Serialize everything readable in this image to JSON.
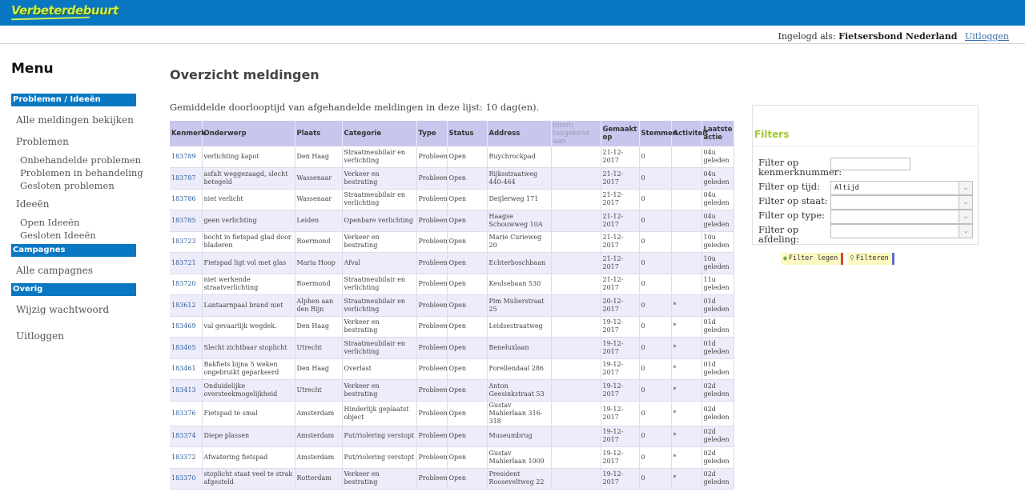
{
  "header": {
    "logo_text": "Verbeterdebuurt",
    "logged_in_prefix": "Ingelogd als:",
    "user_name": "Fietsersbond Nederland",
    "logout_link": "Uitloggen"
  },
  "sidebar": {
    "title": "Menu",
    "section_problems": "Problemen / Ideeën",
    "all_reports": "Alle meldingen bekijken",
    "problems": "Problemen",
    "unhandled": "Onbehandelde problemen",
    "in_progress": "Problemen in behandeling",
    "closed_problems": "Gesloten problemen",
    "ideas": "Ideeën",
    "open_ideas": "Open Ideeën",
    "closed_ideas": "Gesloten Ideeën",
    "section_campaigns": "Campagnes",
    "all_campaigns": "Alle campagnes",
    "section_other": "Overig",
    "change_password": "Wijzig wachtwoord",
    "logout": "Uitloggen"
  },
  "main": {
    "title": "Overzicht meldingen",
    "average_line": "Gemiddelde doorlooptijd van afgehandelde meldingen in deze lijst: 10 dag(en).",
    "columns": {
      "kenmerk": "Kenmerk",
      "onderwerp": "Onderwerp",
      "plaats": "Plaats",
      "categorie": "Categorie",
      "type": "Type",
      "status": "Status",
      "address": "Address",
      "intern": "Intern toegekend aan",
      "gemaakt": "Gemaakt op",
      "stemmen": "Stemmen",
      "activiteit": "Activiteit",
      "laatste": "Laatste actie"
    },
    "rows": [
      {
        "id": "183789",
        "subject": "verlichting kapot",
        "place": "Den Haag",
        "category": "Straatmeubilair en verlichting",
        "type": "Probleem",
        "status": "Open",
        "address": "Ruychrockpad",
        "intern": "",
        "created": "21-12-2017",
        "votes": "0",
        "activity": "",
        "last": "04u geleden"
      },
      {
        "id": "183787",
        "subject": "asfalt weggezaagd, slecht betegeld",
        "place": "Wassenaar",
        "category": "Verkeer en bestrating",
        "type": "Probleem",
        "status": "Open",
        "address": "Rijksstraatweg 440-464",
        "intern": "",
        "created": "21-12-2017",
        "votes": "0",
        "activity": "",
        "last": "04u geleden"
      },
      {
        "id": "183786",
        "subject": "niet verlicht",
        "place": "Wassenaar",
        "category": "Straatmeubilair en verlichting",
        "type": "Probleem",
        "status": "Open",
        "address": "Deijlerweg 171",
        "intern": "",
        "created": "21-12-2017",
        "votes": "0",
        "activity": "",
        "last": "04u geleden"
      },
      {
        "id": "183785",
        "subject": "geen verlichting",
        "place": "Leiden",
        "category": "Openbare verlichting",
        "type": "Probleem",
        "status": "Open",
        "address": "Haagse Schouwweg 10A",
        "intern": "",
        "created": "21-12-2017",
        "votes": "0",
        "activity": "",
        "last": "04u geleden"
      },
      {
        "id": "183723",
        "subject": "bocht in fietspad glad door bladeren",
        "place": "Roermond",
        "category": "Verkeer en bestrating",
        "type": "Probleem",
        "status": "Open",
        "address": "Marie Curieweg 20",
        "intern": "",
        "created": "21-12-2017",
        "votes": "0",
        "activity": "",
        "last": "10u geleden"
      },
      {
        "id": "183721",
        "subject": "Fietspad ligt vol met glas",
        "place": "Maria Hoop",
        "category": "Afval",
        "type": "Probleem",
        "status": "Open",
        "address": "Echterboschbaan",
        "intern": "",
        "created": "21-12-2017",
        "votes": "0",
        "activity": "",
        "last": "10u geleden"
      },
      {
        "id": "183720",
        "subject": "niet werkende straatverlichting",
        "place": "Roermond",
        "category": "Straatmeubilair en verlichting",
        "type": "Probleem",
        "status": "Open",
        "address": "Keulsebaan 530",
        "intern": "",
        "created": "21-12-2017",
        "votes": "0",
        "activity": "",
        "last": "11u geleden"
      },
      {
        "id": "183612",
        "subject": "Lantaarnpaal brand niet",
        "place": "Alphen aan den Rijn",
        "category": "Straatmeubilair en verlichting",
        "type": "Probleem",
        "status": "Open",
        "address": "Pim Mulierstraat 25",
        "intern": "",
        "created": "20-12-2017",
        "votes": "0",
        "activity": "*",
        "last": "01d geleden"
      },
      {
        "id": "183469",
        "subject": "val gevaarlijk wegdek.",
        "place": "Den Haag",
        "category": "Verkeer en bestrating",
        "type": "Probleem",
        "status": "Open",
        "address": "Leidsestraatweg",
        "intern": "",
        "created": "19-12-2017",
        "votes": "0",
        "activity": "*",
        "last": "01d geleden"
      },
      {
        "id": "183465",
        "subject": "Slecht zichtbaar stoplicht",
        "place": "Utrecht",
        "category": "Straatmeubilair en verlichting",
        "type": "Probleem",
        "status": "Open",
        "address": "Beneluxlaan",
        "intern": "",
        "created": "19-12-2017",
        "votes": "0",
        "activity": "*",
        "last": "01d geleden"
      },
      {
        "id": "183461",
        "subject": "Bakfiets bijna 5 weken ongebruikt geparkeerd",
        "place": "Den Haag",
        "category": "Overlast",
        "type": "Probleem",
        "status": "Open",
        "address": "Forellendaal 286",
        "intern": "",
        "created": "19-12-2017",
        "votes": "0",
        "activity": "*",
        "last": "01d geleden"
      },
      {
        "id": "183413",
        "subject": "Onduidelijke oversteekmogelijkheid",
        "place": "Utrecht",
        "category": "Verkeer en bestrating",
        "type": "Probleem",
        "status": "Open",
        "address": "Anton Geesinkstraat 53",
        "intern": "",
        "created": "19-12-2017",
        "votes": "0",
        "activity": "*",
        "last": "02d geleden"
      },
      {
        "id": "183376",
        "subject": "Fietspad te smal",
        "place": "Amsterdam",
        "category": "Hinderlijk geplaatst object",
        "type": "Probleem",
        "status": "Open",
        "address": "Gustav Mahlerlaan 316-318",
        "intern": "",
        "created": "19-12-2017",
        "votes": "0",
        "activity": "*",
        "last": "02d geleden"
      },
      {
        "id": "183374",
        "subject": "Diepe plassen",
        "place": "Amsterdam",
        "category": "Put/riolering verstopt",
        "type": "Probleem",
        "status": "Open",
        "address": "Museumbrug",
        "intern": "",
        "created": "19-12-2017",
        "votes": "0",
        "activity": "*",
        "last": "02d geleden"
      },
      {
        "id": "183372",
        "subject": "Afwatering fietspad",
        "place": "Amsterdam",
        "category": "Put/riolering verstopt",
        "type": "Probleem",
        "status": "Open",
        "address": "Gustav Mahlerlaan 1009",
        "intern": "",
        "created": "19-12-2017",
        "votes": "0",
        "activity": "*",
        "last": "02d geleden"
      },
      {
        "id": "183370",
        "subject": "stoplicht staat veel te strak afgesteld",
        "place": "Rotterdam",
        "category": "Verkeer en bestrating",
        "type": "Probleem",
        "status": "Open",
        "address": "President Rooseveltweg 22",
        "intern": "",
        "created": "19-12-2017",
        "votes": "0",
        "activity": "*",
        "last": "02d geleden"
      }
    ]
  },
  "filters": {
    "title": "Filters",
    "label_number": "Filter op kenmerknummer:",
    "label_time": "Filter op tijd:",
    "time_value": "Altijd",
    "label_state": "Filter op staat:",
    "label_type": "Filter op type:",
    "label_department": "Filter op afdeling:",
    "clear_button": "Filter legen",
    "filter_button": "Filteren"
  }
}
